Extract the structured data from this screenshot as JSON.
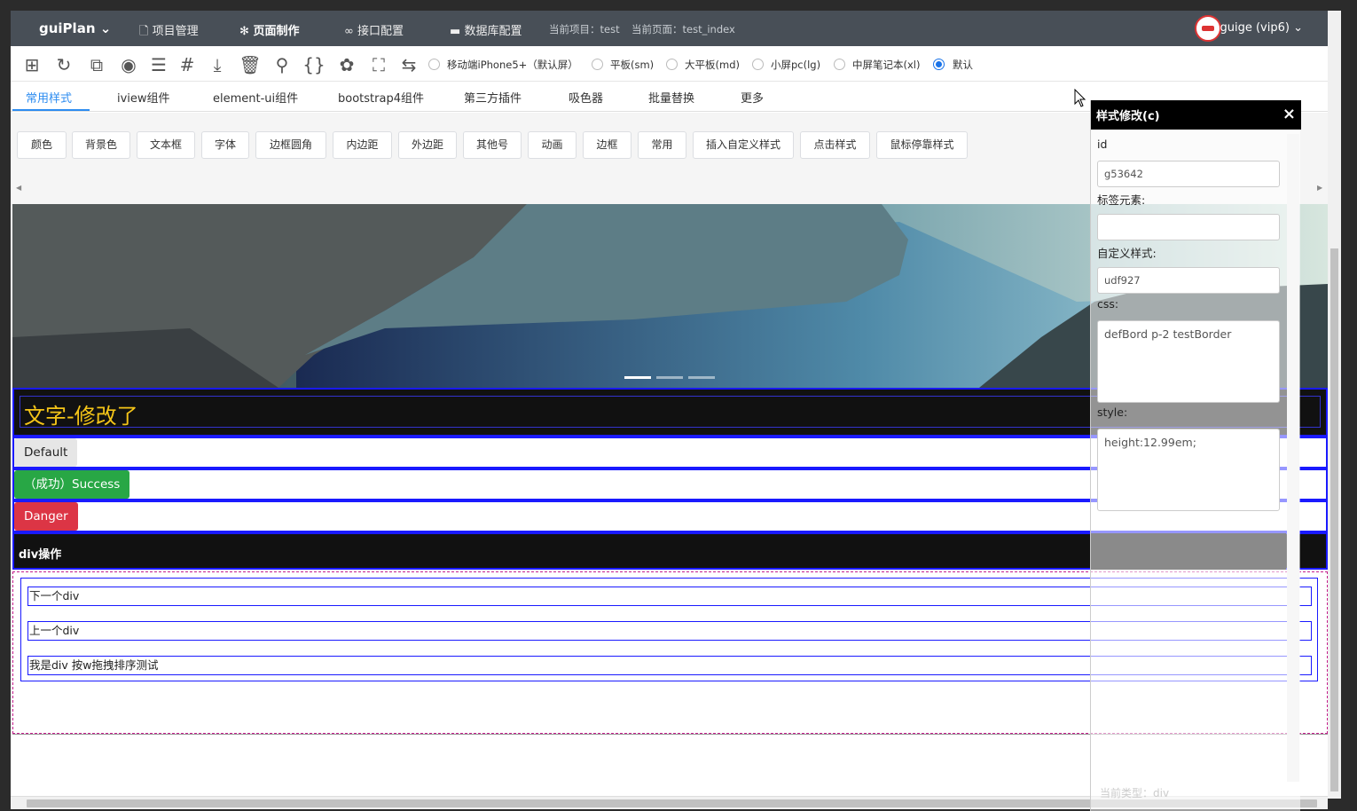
{
  "topnav": {
    "brand": "guiPlan",
    "items": [
      {
        "label": "项目管理"
      },
      {
        "label": "页面制作"
      },
      {
        "label": "接口配置"
      },
      {
        "label": "数据库配置"
      }
    ],
    "current_project": "当前项目：test",
    "current_page": "当前页面：test_index",
    "user": "guige (vip6)"
  },
  "toolbar": {
    "icons": [
      "add-box-icon",
      "refresh-icon",
      "copy-icon",
      "eye-icon",
      "list-icon",
      "hash-icon",
      "download-icon",
      "trash-icon",
      "broom-icon",
      "braces-icon",
      "palette-icon",
      "fullscreen-icon",
      "swap-icon"
    ],
    "screen_options": [
      {
        "label": "移动端iPhone5+（默认屏）",
        "checked": false
      },
      {
        "label": "平板(sm)",
        "checked": false
      },
      {
        "label": "大平板(md)",
        "checked": false
      },
      {
        "label": "小屏pc(lg)",
        "checked": false
      },
      {
        "label": "中屏笔记本(xl)",
        "checked": false
      },
      {
        "label": "默认",
        "checked": true
      }
    ]
  },
  "tabs": [
    {
      "label": "常用样式",
      "active": true
    },
    {
      "label": "iview组件"
    },
    {
      "label": "element-ui组件"
    },
    {
      "label": "bootstrap4组件"
    },
    {
      "label": "第三方插件"
    },
    {
      "label": "吸色器"
    },
    {
      "label": "批量替换"
    },
    {
      "label": "更多"
    }
  ],
  "style_buttons": [
    "颜色",
    "背景色",
    "文本框",
    "字体",
    "边框圆角",
    "内边距",
    "外边距",
    "其他号",
    "动画",
    "边框",
    "常用",
    "插入自定义样式",
    "点击样式",
    "鼠标停靠样式"
  ],
  "content": {
    "title_text": "文字-修改了",
    "btn_default": "Default",
    "btn_success": "（成功）Success",
    "btn_danger": "Danger",
    "div_header": "div操作",
    "div_lines": [
      "下一个div",
      "上一个div",
      "我是div 按w拖拽排序测试"
    ]
  },
  "panel": {
    "title": "样式修改(c)",
    "close": "×",
    "id_label": "id",
    "id_value": "g53642",
    "tag_label": "标签元素:",
    "tag_value": "",
    "custom_label": "自定义样式:",
    "custom_value": "udf927",
    "css_label": "css:",
    "css_value": "defBord p-2 testBorder",
    "style_label": "style:",
    "style_value": "height:12.99em;",
    "footer": "当前类型：div"
  }
}
